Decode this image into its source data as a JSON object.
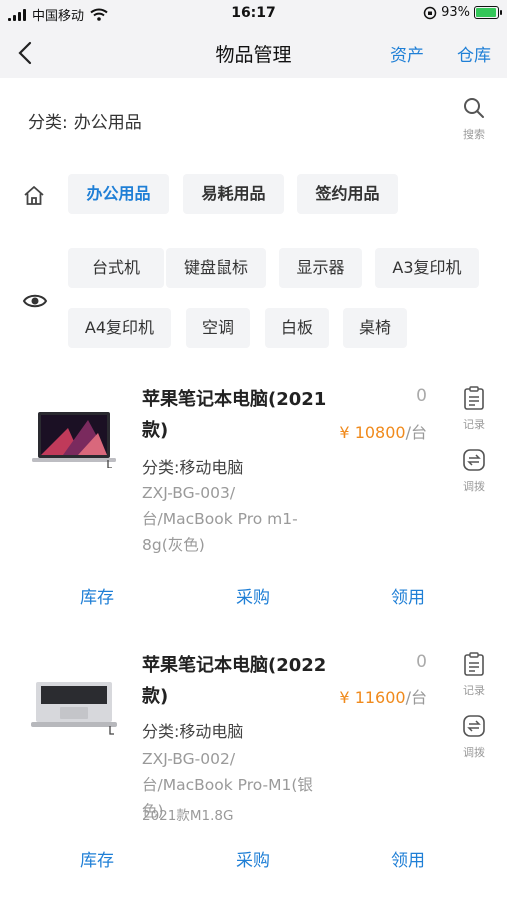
{
  "status_bar": {
    "carrier": "中国移动",
    "time": "16:17",
    "battery": "93%",
    "battery_level": 0.93
  },
  "nav": {
    "title": "物品管理",
    "link_assets": "资产",
    "link_warehouse": "仓库"
  },
  "category": {
    "label": "分类:",
    "value": "办公用品",
    "search_label": "搜索"
  },
  "top_tabs": [
    "办公用品",
    "易耗用品",
    "签约用品"
  ],
  "sub_tags": [
    "台式机",
    "键盘鼠标",
    "显示器",
    "A3复印机",
    "A4复印机",
    "空调",
    "白板",
    "桌椅"
  ],
  "products": [
    {
      "name": "苹果笔记本电脑(2021款)",
      "category": "分类:移动电脑",
      "spec": "ZXJ-BG-003/台/MacBook Pro m1-8g(灰色)",
      "extra": "",
      "qty": "0",
      "price": "¥ 10800",
      "unit": "/台",
      "record_label": "记录",
      "transfer_label": "调拨",
      "stock_label": "库存",
      "purchase_label": "采购",
      "use_label": "领用"
    },
    {
      "name": "苹果笔记本电脑(2022款)",
      "category": "分类:移动电脑",
      "spec": "ZXJ-BG-002/台/MacBook Pro-M1(银色)",
      "extra": "2021款M1.8G",
      "qty": "0",
      "price": "¥ 11600",
      "unit": "/台",
      "record_label": "记录",
      "transfer_label": "调拨",
      "stock_label": "库存",
      "purchase_label": "采购",
      "use_label": "领用"
    }
  ],
  "colors": {
    "accent": "#1f7fd6",
    "price": "#f08a1c",
    "chip_bg": "#f3f4f6"
  }
}
